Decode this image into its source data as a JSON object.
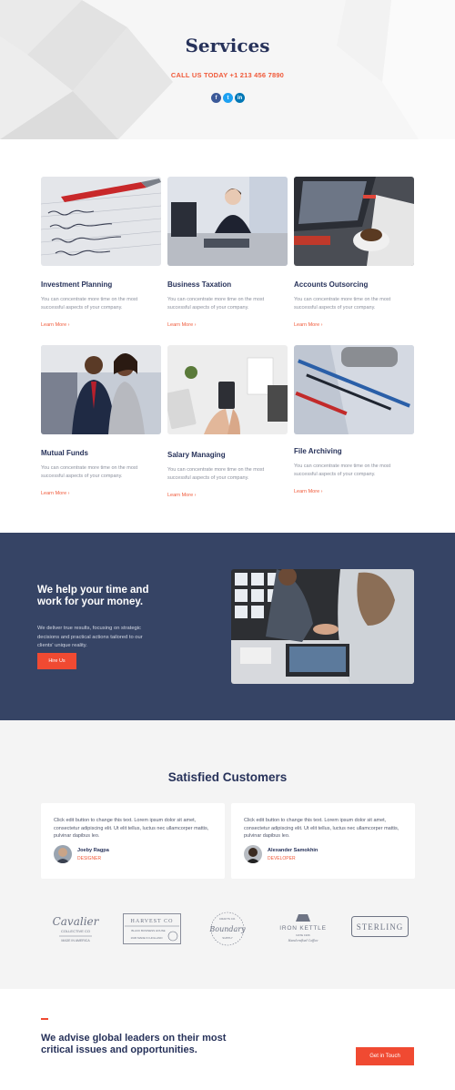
{
  "hero": {
    "title": "Services",
    "call": "CALL US TODAY +1 213 456 7890",
    "socials": [
      "facebook-icon",
      "twitter-icon",
      "linkedin-icon"
    ]
  },
  "services": [
    {
      "title": "Investment Planning",
      "text": "You can concentrate more time on the most successful aspects of your company.",
      "link": "Learn More"
    },
    {
      "title": "Business Taxation",
      "text": "You can concentrate more time on the most successful aspects of your company.",
      "link": "Learn More"
    },
    {
      "title": "Accounts Outsorcing",
      "text": "You can concentrate more time on the most successful aspects of your company.",
      "link": "Learn More"
    },
    {
      "title": "Mutual Funds",
      "text": "You can concentrate more time on the most successful aspects of your company.",
      "link": "Learn More"
    },
    {
      "title": "Salary Managing",
      "text": "You can concentrate more time on the most successful aspects of your company.",
      "link": "Learn More"
    },
    {
      "title": "File Archiving",
      "text": "You can concentrate more time on the most successful aspects of your company.",
      "link": "Learn More"
    }
  ],
  "promo": {
    "title": "We help your time and work for your money.",
    "text": "We deliver true results, focusing on strategic decisions and practical actions tailored to our clients' unique reality.",
    "button": "Hire Us"
  },
  "testimonials": {
    "title": "Satisfied Customers",
    "items": [
      {
        "quote": "Click edit button to change this text. Lorem ipsum dolor sit amet, consectetur adipiscing elit. Ut elit tellus, luctus nec ullamcorper mattis, pulvinar dapibus leo.",
        "name": "Joeby Ragpa",
        "role": "DESIGNER"
      },
      {
        "quote": "Click edit button to change this text. Lorem ipsum dolor sit amet, consectetur adipiscing elit. Ut elit tellus, luctus nec ullamcorper mattis, pulvinar dapibus leo.",
        "name": "Alexander Samokhin",
        "role": "DEVELOPER"
      }
    ]
  },
  "logos": [
    {
      "name": "Cavalier",
      "sub": "COLLECTIVE CO",
      "tag": "MADE IN AMERICA"
    },
    {
      "name": "HARVEST CO",
      "sub": "BLACK BUSINESS HOUSE",
      "tag": "1936 MADE IN HOLLAND"
    },
    {
      "name": "Boundary",
      "sub": "CRAFTS CO.",
      "tag": "SUPPLY"
    },
    {
      "name": "IRON KETTLE",
      "sub": "DATE 1936",
      "tag": "Handcrafted Coffee"
    },
    {
      "name": "STERLING",
      "sub": "",
      "tag": ""
    }
  ],
  "cta": {
    "title": "We advise global leaders on their most critical issues and opportunities.",
    "button": "Get in Touch"
  },
  "colors": {
    "accent": "#f04a32",
    "navy": "#27325a",
    "blue_bg": "#364465"
  }
}
